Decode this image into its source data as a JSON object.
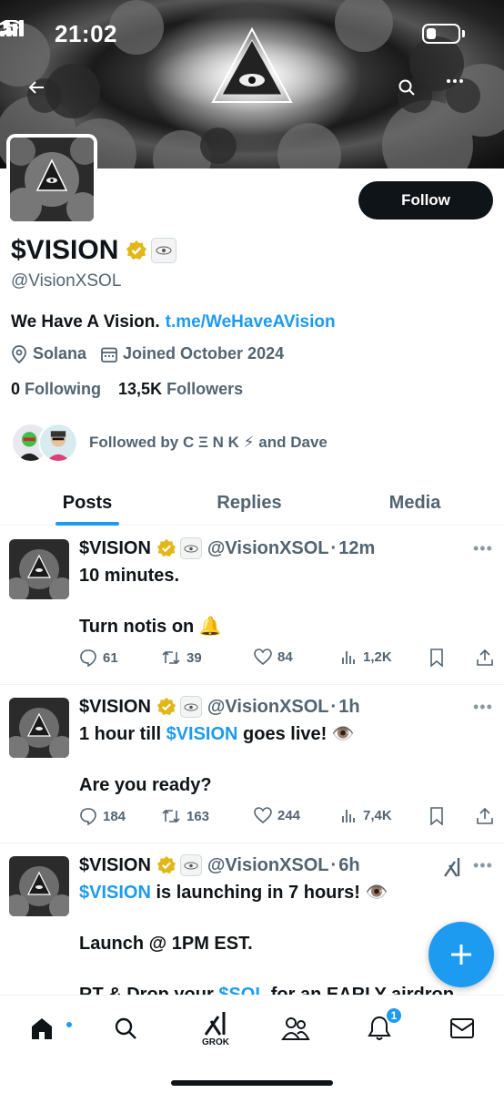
{
  "status_bar": {
    "time": "21:02"
  },
  "profile": {
    "follow_label": "Follow",
    "name": "$VISION",
    "handle": "@VisionXSOL",
    "bio_text": "We Have A Vision.",
    "bio_link": "t.me/WeHaveAVision",
    "location": "Solana",
    "joined": "Joined October 2024",
    "following_count": "0",
    "following_label": "Following",
    "followers_count": "13,5K",
    "followers_label": "Followers",
    "followed_by": "Followed by C Ξ N K ⚡ and Dave"
  },
  "tabs": [
    {
      "label": "Posts",
      "active": true
    },
    {
      "label": "Replies",
      "active": false
    },
    {
      "label": "Media",
      "active": false
    }
  ],
  "posts": [
    {
      "name": "$VISION",
      "handle": "@VisionXSOL",
      "time": "12m",
      "line1": "10 minutes.",
      "line2": "Turn notis on 🔔",
      "replies": "61",
      "reposts": "39",
      "likes": "84",
      "views": "1,2K"
    },
    {
      "name": "$VISION",
      "handle": "@VisionXSOL",
      "time": "1h",
      "line1_prefix": "1 hour till ",
      "line1_highlight": "$VISION",
      "line1_suffix": " goes live! 👁️",
      "line2": "Are you ready?",
      "replies": "184",
      "reposts": "163",
      "likes": "244",
      "views": "7,4K"
    },
    {
      "name": "$VISION",
      "handle": "@VisionXSOL",
      "time": "6h",
      "line1_highlight": "$VISION",
      "line1_suffix": " is launching in 7 hours! 👁️",
      "line2": "Launch @ 1PM EST.",
      "line3_prefix": "RT & Drop your ",
      "line3_highlight": "$SOL",
      "line3_suffix": " for an EARLY airdrop"
    }
  ],
  "nav": {
    "grok_label": "GROK",
    "notifications_count": "1"
  },
  "colors": {
    "accent": "#1d9bf0",
    "text": "#0f1419",
    "muted": "#536471"
  }
}
